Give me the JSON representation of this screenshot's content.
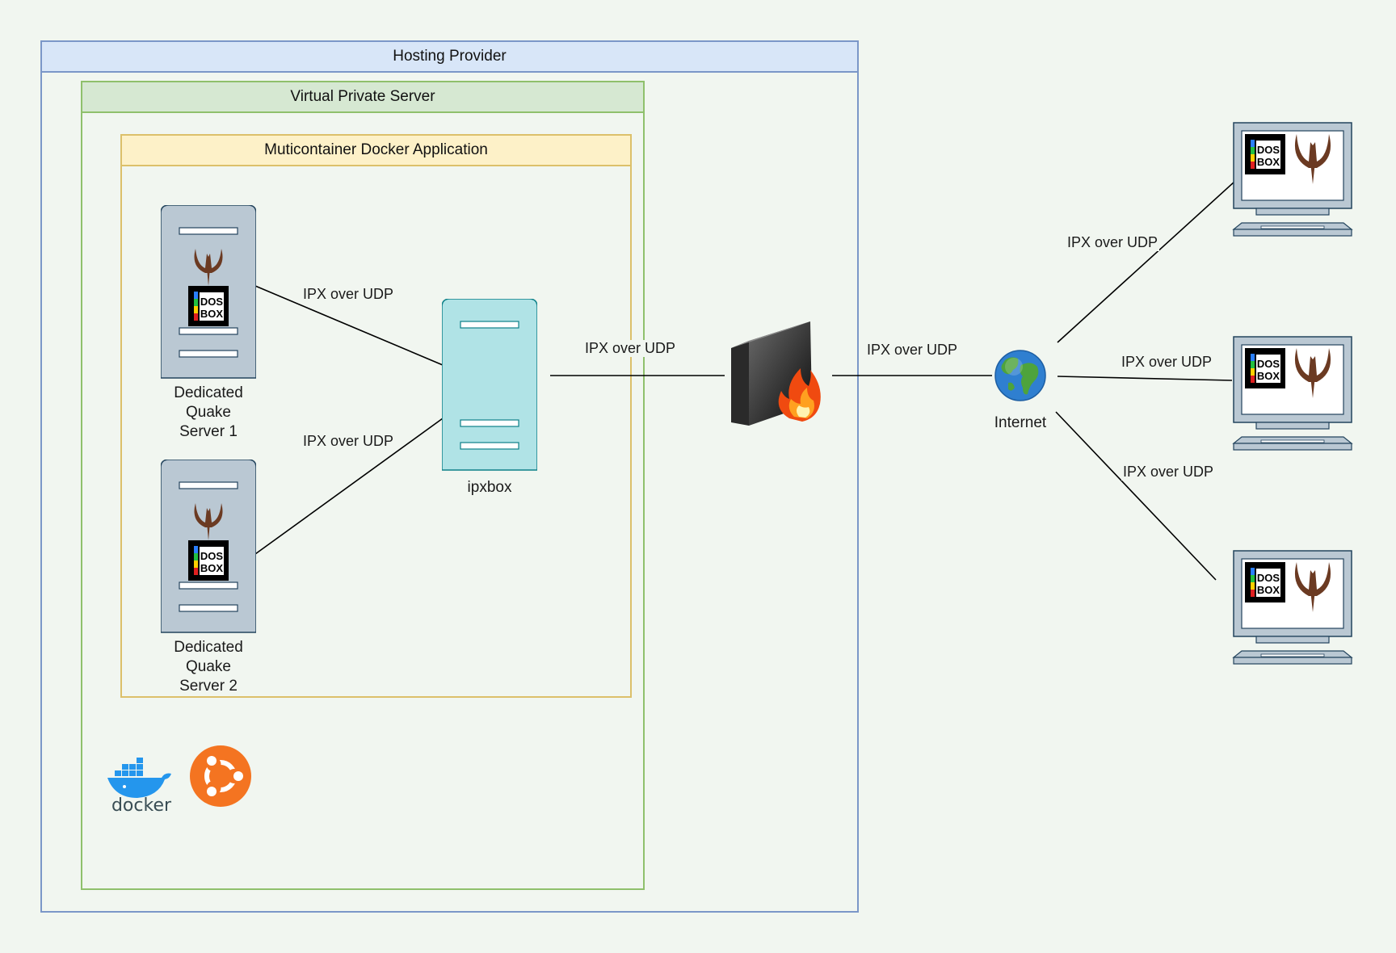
{
  "containers": {
    "hosting_provider": "Hosting Provider",
    "virtual_private_server": "Virtual Private Server",
    "docker_application": "Muticontainer Docker Application"
  },
  "nodes": {
    "quake_server_1": "Dedicated\nQuake\nServer 1",
    "quake_server_2": "Dedicated\nQuake\nServer 2",
    "ipxbox": "ipxbox",
    "internet": "Internet"
  },
  "logos": {
    "docker": "docker",
    "dosbox": "DOS BOX"
  },
  "edges": {
    "server1_ipxbox": "IPX over UDP",
    "server2_ipxbox": "IPX over UDP",
    "ipxbox_firewall": "IPX over UDP",
    "firewall_internet": "IPX over UDP",
    "internet_client1": "IPX over UDP",
    "internet_client2": "IPX over UDP",
    "internet_client3": "IPX over UDP"
  },
  "icons": [
    "server-icon",
    "quake-logo-icon",
    "dosbox-logo-icon",
    "firewall-icon",
    "globe-icon",
    "monitor-icon",
    "docker-logo-icon",
    "ubuntu-logo-icon"
  ],
  "colors": {
    "background": "#f1f6f0",
    "hosting_border": "#7b97c8",
    "hosting_header": "#d8e6f8",
    "vps_border": "#8fc06c",
    "vps_header": "#d6e8d2",
    "docker_border": "#dcc06a",
    "docker_header": "#fdf1c8",
    "server_fill": "#bac8d3",
    "ipxbox_fill": "#b0e3e6",
    "ubuntu_orange": "#f47421",
    "docker_blue": "#2496ed"
  }
}
